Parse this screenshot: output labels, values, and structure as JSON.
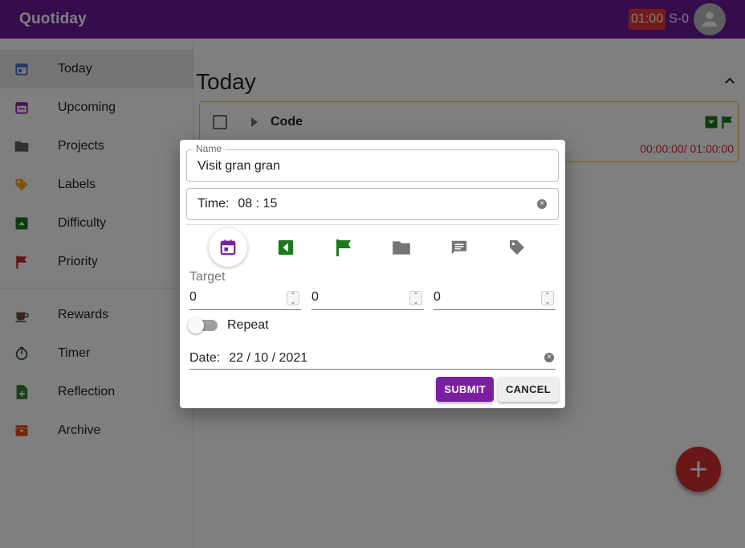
{
  "app": {
    "title": "Quotiday",
    "timer_badge": "01:00",
    "score": "S-0"
  },
  "sidebar": {
    "primary": [
      {
        "label": "Today",
        "icon": "calendar-today-icon",
        "color": "#3f6fd8"
      },
      {
        "label": "Upcoming",
        "icon": "calendar-upcoming-icon",
        "color": "#8e24aa"
      },
      {
        "label": "Projects",
        "icon": "folder-icon",
        "color": "#616161"
      },
      {
        "label": "Labels",
        "icon": "tag-icon",
        "color": "#f9a825"
      },
      {
        "label": "Difficulty",
        "icon": "difficulty-icon",
        "color": "#1b7a1b"
      },
      {
        "label": "Priority",
        "icon": "flag-icon",
        "color": "#c62828"
      }
    ],
    "secondary": [
      {
        "label": "Rewards",
        "icon": "coffee-icon",
        "color": "#6d4c41"
      },
      {
        "label": "Timer",
        "icon": "stopwatch-icon",
        "color": "#37474f"
      },
      {
        "label": "Reflection",
        "icon": "note-add-icon",
        "color": "#2e7d32"
      },
      {
        "label": "Archive",
        "icon": "archive-icon",
        "color": "#e64a19"
      }
    ]
  },
  "main": {
    "title": "Today",
    "task": {
      "name": "Code",
      "time": "00:00:00/ 01:00:00"
    }
  },
  "dialog": {
    "name_label": "Name",
    "name_value": "Visit gran gran",
    "time_label": "Time:",
    "time_value": "08 : 15",
    "target_label": "Target",
    "target_values": [
      "0",
      "0",
      "0"
    ],
    "repeat_label": "Repeat",
    "date_label": "Date:",
    "date_value": "22 / 10 / 2021",
    "submit_label": "SUBMIT",
    "cancel_label": "CANCEL"
  },
  "colors": {
    "appbar": "#6a1b9a",
    "accent": "#7b1fa2",
    "danger": "#d32f2f",
    "green": "#1b7a1b"
  }
}
